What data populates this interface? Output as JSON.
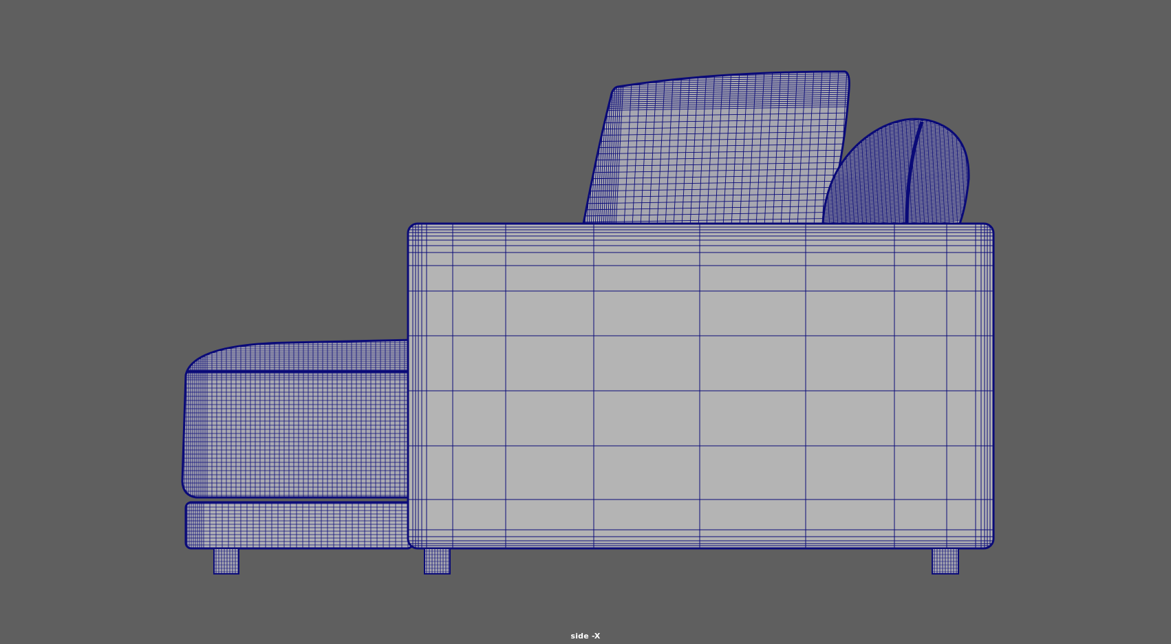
{
  "viewport": {
    "camera_label": "side -X",
    "background_color": "#5f5f5f"
  },
  "model": {
    "display_mode": "wireframe-on-shaded",
    "wire_color": "#0a0a78",
    "shade_color": "#b4b4b4",
    "parts": [
      "back-cushion",
      "side-cushion",
      "armrest",
      "seat-cushion",
      "seat-base",
      "leg-left",
      "leg-middle",
      "leg-right"
    ]
  }
}
